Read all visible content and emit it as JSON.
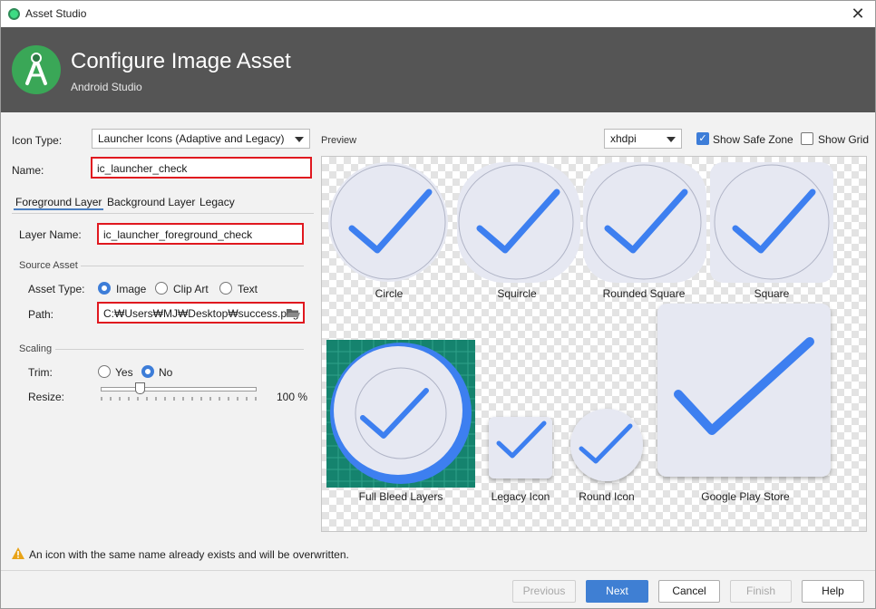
{
  "window": {
    "title": "Asset Studio",
    "close": "✕"
  },
  "header": {
    "title": "Configure Image Asset",
    "subtitle": "Android Studio"
  },
  "form": {
    "icon_type_label": "Icon Type:",
    "icon_type_value": "Launcher Icons (Adaptive and Legacy)",
    "name_label": "Name:",
    "name_value": "ic_launcher_check",
    "tabs": [
      "Foreground Layer",
      "Background Layer",
      "Legacy"
    ],
    "layer_name_label": "Layer Name:",
    "layer_name_value": "ic_launcher_foreground_check",
    "source_asset_label": "Source Asset",
    "asset_type_label": "Asset Type:",
    "asset_types": [
      "Image",
      "Clip Art",
      "Text"
    ],
    "asset_type_selected": "Image",
    "path_label": "Path:",
    "path_value": "C:₩Users₩MJ₩Desktop₩success.png",
    "scaling_label": "Scaling",
    "trim_label": "Trim:",
    "trim_options": [
      "Yes",
      "No"
    ],
    "trim_selected": "No",
    "resize_label": "Resize:",
    "resize_value": "100 %"
  },
  "preview": {
    "label": "Preview",
    "density": "xhdpi",
    "show_safe_zone_label": "Show Safe Zone",
    "show_safe_zone": true,
    "show_grid_label": "Show Grid",
    "show_grid": false,
    "icons": [
      "Circle",
      "Squircle",
      "Rounded Square",
      "Square",
      "Full Bleed Layers",
      "Legacy Icon",
      "Round Icon",
      "Google Play Store"
    ]
  },
  "warning": "An icon with the same name already exists and will be overwritten.",
  "buttons": {
    "previous": "Previous",
    "next": "Next",
    "cancel": "Cancel",
    "finish": "Finish",
    "help": "Help"
  },
  "colors": {
    "accent": "#3f7fd3",
    "check": "#3d7ff0",
    "error_border": "#e0181f",
    "header_bg": "#555555"
  }
}
